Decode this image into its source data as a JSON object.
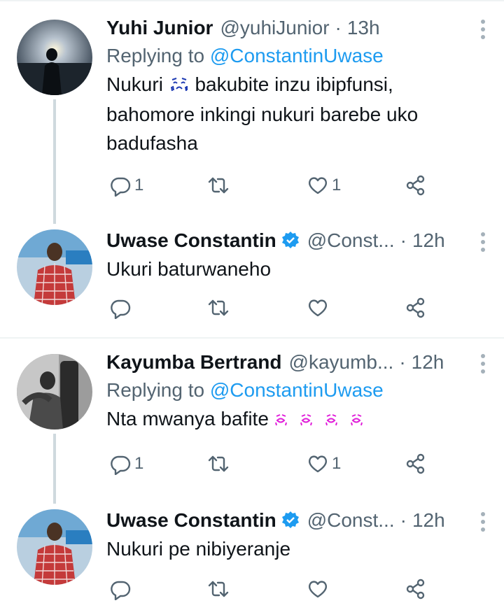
{
  "tweets": [
    {
      "name": "Yuhi Junior",
      "handle": "@yuhiJunior",
      "time": "13h",
      "replying_label": "Replying to",
      "replying_to": "@ConstantinUwase",
      "text_lines": [
        "Nukuri",
        "bakubite inzu ibipfunsi,",
        "bahomore inkingi nukuri barebe uko",
        "badufasha"
      ],
      "emoji": "crying-face",
      "replies": "1",
      "retweets": "",
      "likes": "1",
      "avatar": "silhouette-sunset"
    },
    {
      "name": "Uwase Constantin",
      "handle": "@Const...",
      "time": "12h",
      "verified": true,
      "text": "Ukuri baturwaneho",
      "replies": "",
      "retweets": "",
      "likes": "",
      "avatar": "man-red-shirt"
    },
    {
      "name": "Kayumba Bertrand",
      "handle": "@kayumb...",
      "time": "12h",
      "replying_label": "Replying to",
      "replying_to": "@ConstantinUwase",
      "text": "Nta mwanya bafite",
      "emoji": "kissing-lips x4",
      "replies": "1",
      "retweets": "",
      "likes": "1",
      "avatar": "grayscale-man"
    },
    {
      "name": "Uwase Constantin",
      "handle": "@Const...",
      "time": "12h",
      "verified": true,
      "text": "Nukuri pe  nibiyeranje",
      "avatar": "man-red-shirt"
    }
  ],
  "dot": "·",
  "colors": {
    "accent": "#1d9bf0",
    "secondary": "#536471",
    "divider": "#eff3f4",
    "thread": "#cfd9de"
  }
}
